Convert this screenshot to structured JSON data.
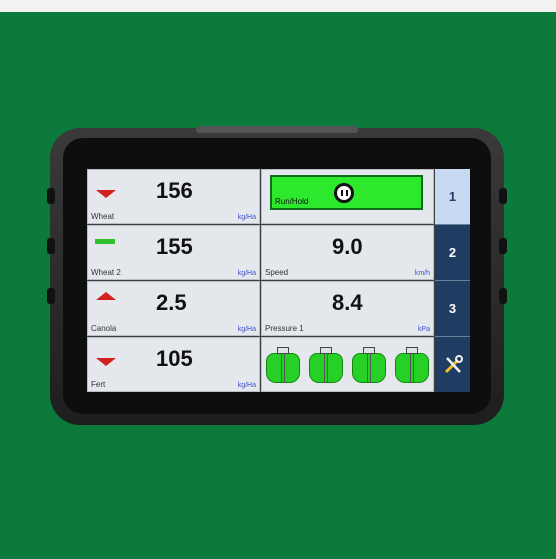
{
  "products": [
    {
      "name": "Wheat",
      "value": "156",
      "unit": "kg/Ha",
      "indicator": "decrease"
    },
    {
      "name": "Wheat 2",
      "value": "155",
      "unit": "kg/Ha",
      "indicator": "hold"
    },
    {
      "name": "Canola",
      "value": "2.5",
      "unit": "kg/Ha",
      "indicator": "increase"
    },
    {
      "name": "Fert",
      "value": "105",
      "unit": "kg/Ha",
      "indicator": "decrease"
    }
  ],
  "run_hold": {
    "label": "Run/Hold",
    "state": "paused"
  },
  "readouts": [
    {
      "name": "Speed",
      "value": "9.0",
      "unit": "km/h"
    },
    {
      "name": "Pressure 1",
      "value": "8.4",
      "unit": "kPa"
    }
  ],
  "tabs": [
    {
      "label": "1",
      "active": true
    },
    {
      "label": "2",
      "active": false
    },
    {
      "label": "3",
      "active": false
    },
    {
      "label": "",
      "icon": "tools-icon",
      "active": false
    }
  ],
  "colors": {
    "background": "#0b7a3a",
    "run_active": "#2ee82e",
    "decrease_arrow": "#d32020",
    "tab_active": "#c8daf2",
    "tab_inactive": "#1f3c63",
    "tank_fill": "#27d027"
  }
}
